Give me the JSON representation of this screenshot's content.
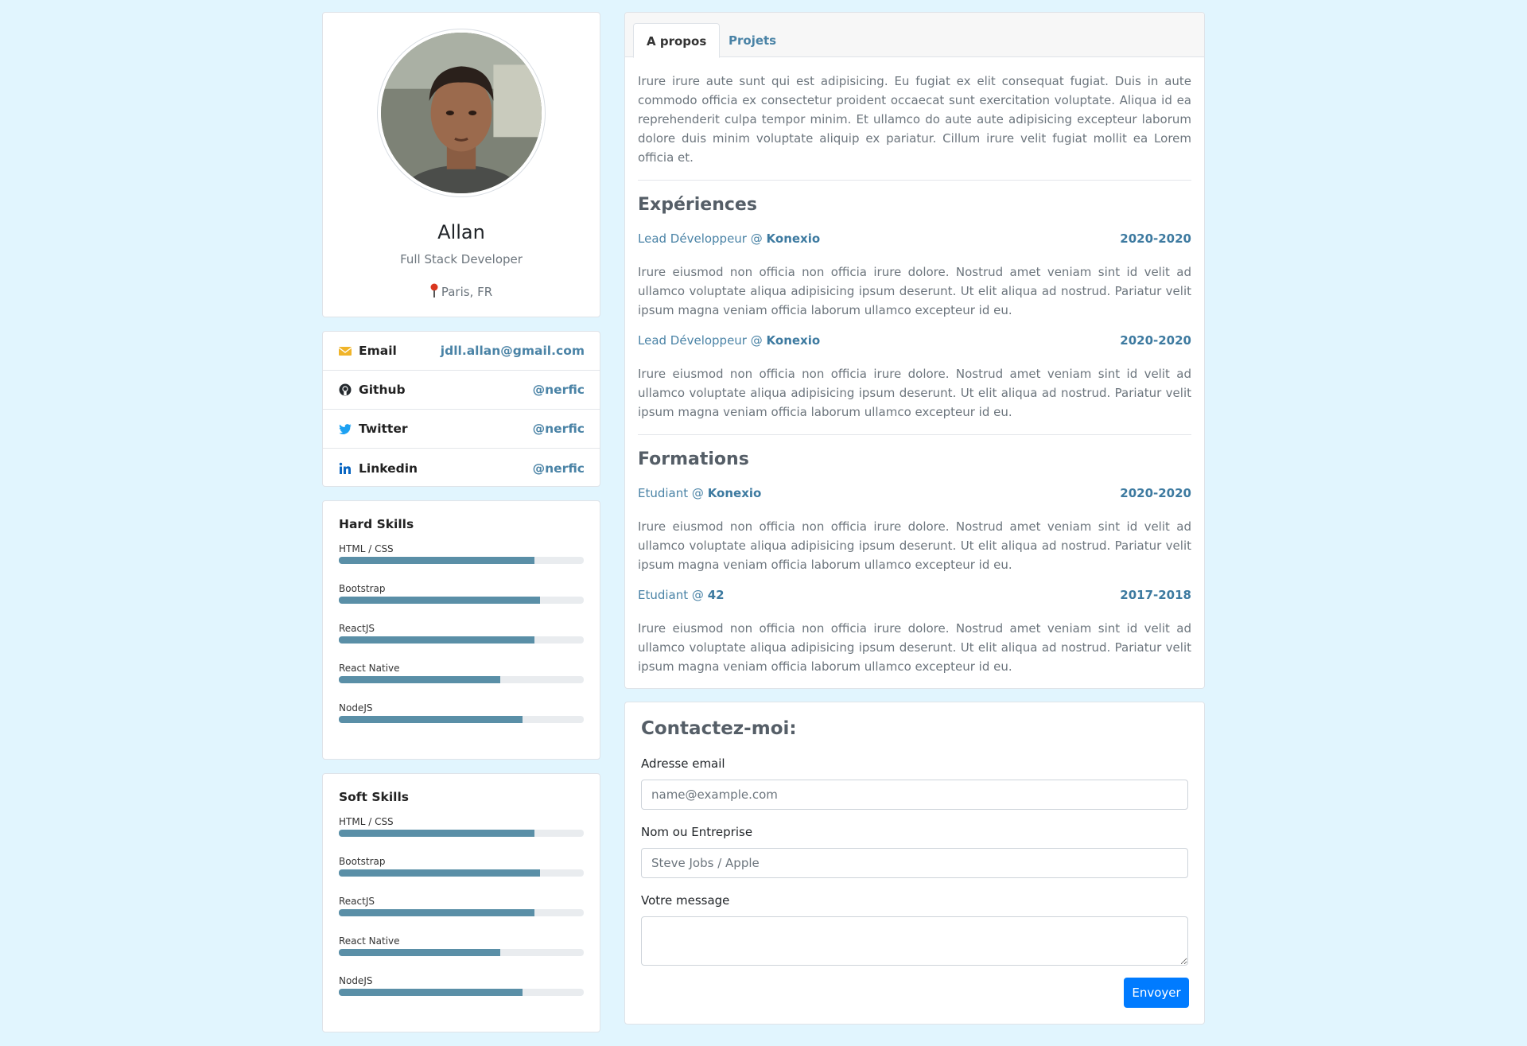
{
  "profile": {
    "name": "Allan",
    "role": "Full Stack Developer",
    "location": "Paris, FR"
  },
  "contacts": [
    {
      "label": "Email",
      "value": "jdll.allan@gmail.com",
      "icon": "envelope-icon"
    },
    {
      "label": "Github",
      "value": "@nerfic",
      "icon": "github-icon"
    },
    {
      "label": "Twitter",
      "value": "@nerfic",
      "icon": "twitter-icon"
    },
    {
      "label": "Linkedin",
      "value": "@nerfic",
      "icon": "linkedin-icon"
    }
  ],
  "hard_skills": {
    "title": "Hard Skills",
    "items": [
      {
        "name": "HTML / CSS",
        "level": 0.8
      },
      {
        "name": "Bootstrap",
        "level": 0.82
      },
      {
        "name": "ReactJS",
        "level": 0.8
      },
      {
        "name": "React Native",
        "level": 0.66
      },
      {
        "name": "NodeJS",
        "level": 0.75
      }
    ]
  },
  "soft_skills": {
    "title": "Soft Skills",
    "items": [
      {
        "name": "HTML / CSS",
        "level": 0.8
      },
      {
        "name": "Bootstrap",
        "level": 0.82
      },
      {
        "name": "ReactJS",
        "level": 0.8
      },
      {
        "name": "React Native",
        "level": 0.66
      },
      {
        "name": "NodeJS",
        "level": 0.75
      }
    ]
  },
  "tabs": [
    "A propos",
    "Projets"
  ],
  "about": "Irure irure aute sunt qui est adipisicing. Eu fugiat ex elit consequat fugiat. Duis in aute commodo officia ex consectetur proident occaecat sunt exercitation voluptate. Aliqua id ea reprehenderit culpa tempor minim. Et ullamco do aute aute adipisicing excepteur laborum dolore duis minim voluptate aliquip ex pariatur. Cillum irure velit fugiat mollit ea Lorem officia et.",
  "experiences": {
    "title": "Expériences",
    "items": [
      {
        "position": "Lead Développeur",
        "company": "Konexio",
        "dates": "2020-2020",
        "description": "Irure eiusmod non officia non officia irure dolore. Nostrud amet veniam sint id velit ad ullamco voluptate aliqua adipisicing ipsum deserunt. Ut elit aliqua ad nostrud. Pariatur velit ipsum magna veniam officia laborum ullamco excepteur id eu."
      },
      {
        "position": "Lead Développeur",
        "company": "Konexio",
        "dates": "2020-2020",
        "description": "Irure eiusmod non officia non officia irure dolore. Nostrud amet veniam sint id velit ad ullamco voluptate aliqua adipisicing ipsum deserunt. Ut elit aliqua ad nostrud. Pariatur velit ipsum magna veniam officia laborum ullamco excepteur id eu."
      }
    ]
  },
  "formations": {
    "title": "Formations",
    "items": [
      {
        "position": "Etudiant",
        "company": "Konexio",
        "dates": "2020-2020",
        "description": "Irure eiusmod non officia non officia irure dolore. Nostrud amet veniam sint id velit ad ullamco voluptate aliqua adipisicing ipsum deserunt. Ut elit aliqua ad nostrud. Pariatur velit ipsum magna veniam officia laborum ullamco excepteur id eu."
      },
      {
        "position": "Etudiant",
        "company": "42",
        "dates": "2017-2018",
        "description": "Irure eiusmod non officia non officia irure dolore. Nostrud amet veniam sint id velit ad ullamco voluptate aliqua adipisicing ipsum deserunt. Ut elit aliqua ad nostrud. Pariatur velit ipsum magna veniam officia laborum ullamco excepteur id eu."
      }
    ]
  },
  "contact_form": {
    "title": "Contactez-moi:",
    "email_label": "Adresse email",
    "email_placeholder": "name@example.com",
    "name_label": "Nom ou Entreprise",
    "name_placeholder": "Steve Jobs / Apple",
    "message_label": "Votre message",
    "submit_label": "Envoyer"
  },
  "colors": {
    "page_background": "#e1f5fe",
    "accent": "#4a83a6",
    "skill_bar": "#5a8fa7",
    "primary_button": "#007bff"
  }
}
